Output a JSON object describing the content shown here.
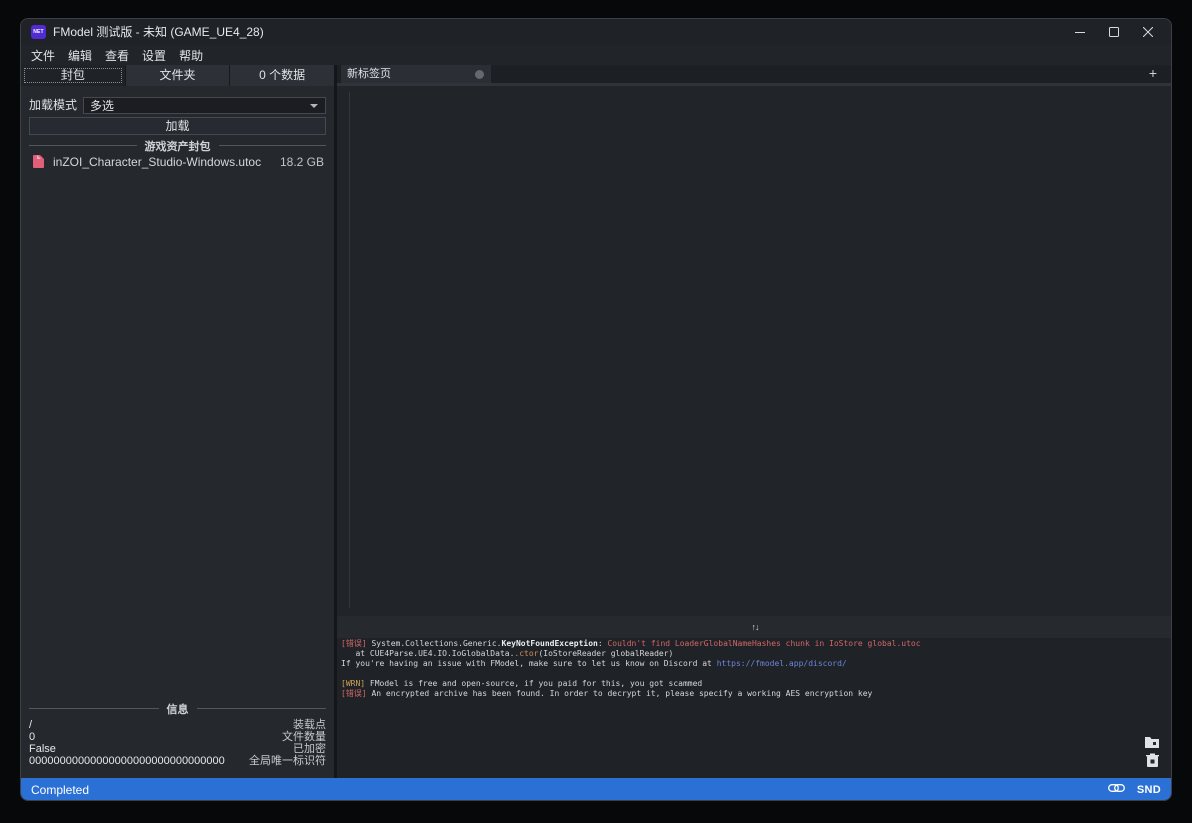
{
  "window": {
    "title": "FModel 测试版 - 未知 (GAME_UE4_28)",
    "icon_label": "NET"
  },
  "menu": {
    "items": [
      "文件",
      "编辑",
      "查看",
      "设置",
      "帮助"
    ]
  },
  "left_panel": {
    "tabs": [
      {
        "label": "封包",
        "selected": true
      },
      {
        "label": "文件夹",
        "selected": false
      },
      {
        "label": "0 个数据",
        "selected": false
      }
    ],
    "load_mode_label": "加载模式",
    "load_mode_value": "多选",
    "load_button_label": "加载",
    "archives_header": "游戏资产封包",
    "files": [
      {
        "name": "inZOI_Character_Studio-Windows.utoc",
        "size": "18.2 GB"
      }
    ],
    "info_header": "信息",
    "info_rows": [
      {
        "value": "/",
        "label": "装载点"
      },
      {
        "value": "0",
        "label": "文件数量"
      },
      {
        "value": "False",
        "label": "已加密"
      },
      {
        "value": "00000000000000000000000000000000",
        "label": "全局唯一标识符"
      }
    ]
  },
  "right_panel": {
    "tab_label": "新标签页",
    "new_tab_button_label": "+"
  },
  "splitter": {
    "icon_glyph": "↑↓"
  },
  "log": {
    "lines": [
      {
        "segments": [
          {
            "t": "[错误] ",
            "c": "red"
          },
          {
            "t": "System.Collections.Generic.",
            "c": "fg"
          },
          {
            "t": "KeyNotFoundException",
            "c": "bold"
          },
          {
            "t": ": ",
            "c": "fg"
          },
          {
            "t": "Couldn't find LoaderGlobalNameHashes chunk in IoStore global.utoc",
            "c": "red"
          }
        ]
      },
      {
        "segments": [
          {
            "t": "   at CUE4Parse.UE4.IO.IoGlobalData.",
            "c": "fg"
          },
          {
            "t": ".ctor",
            "c": "orange"
          },
          {
            "t": "(IoStoreReader globalReader)",
            "c": "fg"
          }
        ]
      },
      {
        "segments": [
          {
            "t": "If you're having an issue with FModel, make sure to let us know on Discord at ",
            "c": "fg"
          },
          {
            "t": "https://fmodel.app/discord/",
            "c": "link"
          }
        ]
      },
      {
        "segments": []
      },
      {
        "segments": [
          {
            "t": "[WRN] ",
            "c": "warn"
          },
          {
            "t": "FModel is free and open-source, if you paid for this, you got scammed",
            "c": "fg"
          }
        ]
      },
      {
        "segments": [
          {
            "t": "[错误] ",
            "c": "red"
          },
          {
            "t": "An encrypted archive has been found. In order to decrypt it, please specify a working AES encryption key",
            "c": "fg"
          }
        ]
      }
    ]
  },
  "status_bar": {
    "status": "Completed",
    "right_label": "SND"
  },
  "colors": {
    "accent_blue": "#2b70d4",
    "log_red": "#d16868",
    "log_warn": "#d2a157",
    "log_orange": "#cc8f5e",
    "log_link": "#6b87d8",
    "file_icon_pink": "#e0607a",
    "dotnet_purple": "#512bd4"
  }
}
